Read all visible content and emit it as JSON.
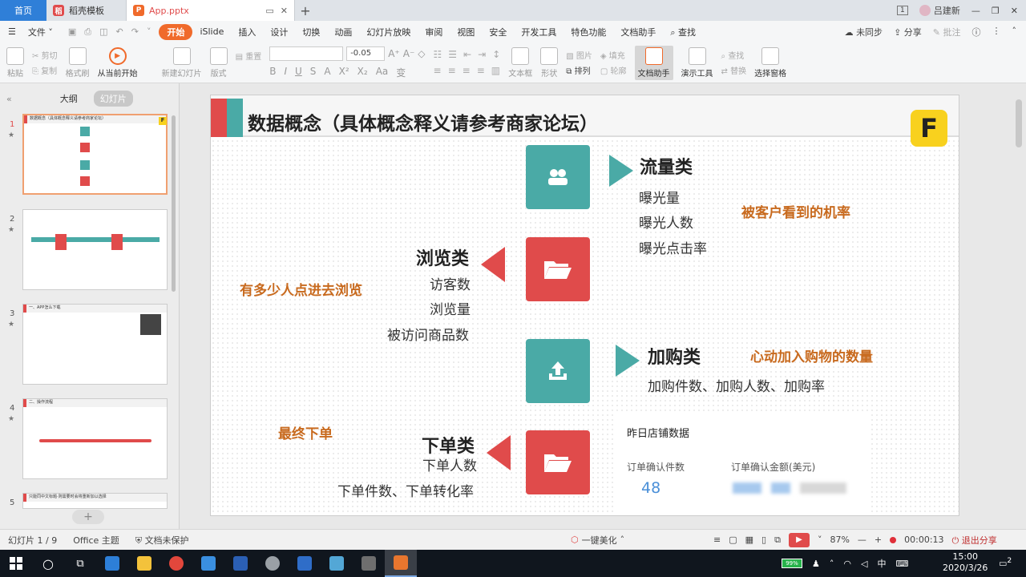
{
  "tabs": {
    "home": "首页",
    "template": "稻壳模板",
    "document": "App.pptx"
  },
  "window": {
    "badge": "1",
    "user": "吕建新"
  },
  "menu": {
    "file": "文件",
    "items": [
      "开始",
      "iSlide",
      "插入",
      "设计",
      "切换",
      "动画",
      "幻灯片放映",
      "审阅",
      "视图",
      "安全",
      "开发工具",
      "特色功能",
      "文档助手"
    ],
    "search": "查找",
    "sync": "未同步",
    "share": "分享",
    "comment": "批注"
  },
  "ribbon": {
    "paste": "粘贴",
    "cut": "剪切",
    "copy": "复制",
    "format_painter": "格式刷",
    "play_from_current": "从当前开始",
    "new_slide": "新建幻灯片",
    "layout": "版式",
    "reset": "重置",
    "font_size": "-0.05",
    "textbox": "文本框",
    "shape": "形状",
    "arrange": "排列",
    "picture": "图片",
    "fill": "填充",
    "outline": "轮廓",
    "doc_assistant": "文档助手",
    "presentation_tools": "演示工具",
    "find": "查找",
    "replace": "替换",
    "select_pane": "选择窗格"
  },
  "left_pane": {
    "tab_outline": "大纲",
    "tab_slides": "幻灯片",
    "slide_numbers": [
      "1",
      "2",
      "3",
      "4",
      "5"
    ],
    "slide3_header": "一、APP怎么下载",
    "slide4_header": "二、操作流程",
    "slide5_header": "只能同中文标题·则需要时会将重新加以选择"
  },
  "slide": {
    "title": "数据概念（具体概念释义请参考商家论坛）",
    "logo": "F",
    "traffic": {
      "title": "流量类",
      "items": [
        "曝光量",
        "曝光人数",
        "曝光点击率"
      ],
      "note": "被客户看到的机率"
    },
    "browse": {
      "title": "浏览类",
      "items": [
        "访客数",
        "浏览量",
        "被访问商品数"
      ],
      "note": "有多少人点进去浏览"
    },
    "cart": {
      "title": "加购类",
      "items": [
        "加购件数、加购人数、加购率"
      ],
      "note": "心动加入购物的数量"
    },
    "order": {
      "title": "下单类",
      "items": [
        "下单人数",
        "下单件数、下单转化率"
      ],
      "note": "最终下单"
    },
    "card": {
      "title": "昨日店铺数据",
      "label1": "订单确认件数",
      "label2": "订单确认金额(美元)",
      "value1": "48"
    }
  },
  "status": {
    "slide_info": "幻灯片 1 / 9",
    "theme": "Office 主题",
    "protect": "文档未保护",
    "beautify": "一键美化",
    "zoom": "87%",
    "timer": "00:00:13",
    "exit_share": "退出分享"
  },
  "taskbar": {
    "battery": "99%",
    "ime": "中",
    "time": "15:00",
    "date": "2020/3/26",
    "notif": "2"
  },
  "colors": {
    "accent_orange": "#f06a2b",
    "red": "#e04b4b",
    "teal": "#4aaaa6",
    "note_orange": "#c86a1e",
    "blue_value": "#4a8fd8"
  }
}
